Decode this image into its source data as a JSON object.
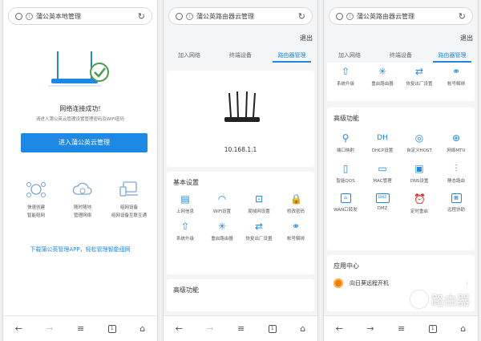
{
  "colors": {
    "accent": "#1e88e5",
    "success": "#43a047"
  },
  "phone1": {
    "url_title": "蒲公英本地管理",
    "success_title": "网络连接成功!",
    "success_sub": "请进入蒲公英云管理设置管理密码及WiFi密码",
    "enter_button": "进入蒲公英云管理",
    "features": [
      {
        "icon": "network-icon",
        "line1": "快速创建",
        "line2": "智能组网"
      },
      {
        "icon": "cloud-gear-icon",
        "line1": "随时随地",
        "line2": "管理网络"
      },
      {
        "icon": "devices-icon",
        "line1": "组网设备",
        "line2": "组网设备互联互通"
      }
    ],
    "download_link": "下载蒲公英管理APP，轻松管理智能组网",
    "nav": [
      "←",
      "→",
      "≡",
      "1",
      "⌂"
    ]
  },
  "phone2": {
    "url_title": "蒲公英路由器云管理",
    "logout": "退出",
    "tabs": [
      "加入网络",
      "终端设备",
      "路由器管理"
    ],
    "ip": "10.168.1.1",
    "basic_title": "基本设置",
    "basic_items": [
      {
        "icon": "doc-icon",
        "glyph": "▤",
        "label": "上网信息"
      },
      {
        "icon": "wifi-icon",
        "glyph": "◠",
        "label": "WiFi设置"
      },
      {
        "icon": "lan-icon",
        "glyph": "⊡",
        "label": "局域网设置"
      },
      {
        "icon": "lock-icon",
        "glyph": "🔒",
        "label": "修改密码"
      },
      {
        "icon": "upgrade-icon",
        "glyph": "⇧",
        "label": "系统升级"
      },
      {
        "icon": "restart-icon",
        "glyph": "✳",
        "label": "重启路由器"
      },
      {
        "icon": "reset-icon",
        "glyph": "⇄",
        "label": "恢复出厂设置"
      },
      {
        "icon": "unbind-icon",
        "glyph": "⚭",
        "label": "帐号解绑"
      }
    ],
    "advanced_title": "高级功能",
    "nav": [
      "←",
      "→",
      "≡",
      "1",
      "⌂"
    ]
  },
  "phone3": {
    "url_title": "蒲公英路由器云管理",
    "logout": "退出",
    "tabs": [
      "加入网络",
      "终端设备",
      "路由器管理"
    ],
    "top_items": [
      {
        "icon": "upgrade-icon",
        "glyph": "⇧",
        "label": "系统升级"
      },
      {
        "icon": "restart-icon",
        "glyph": "✳",
        "label": "重启路由器"
      },
      {
        "icon": "reset-icon",
        "glyph": "⇄",
        "label": "恢复出厂设置"
      },
      {
        "icon": "unbind-icon",
        "glyph": "⚭",
        "label": "帐号解绑"
      }
    ],
    "advanced_title": "高级功能",
    "advanced_items": [
      {
        "icon": "port-map-icon",
        "glyph": "⚲",
        "label": "端口映射",
        "box": false
      },
      {
        "icon": "dhcp-icon",
        "glyph": "DH",
        "label": "DHCP设置",
        "box": false
      },
      {
        "icon": "host-icon",
        "glyph": "◎",
        "label": "自定义HOST",
        "box": false
      },
      {
        "icon": "mtu-icon",
        "glyph": "⊕",
        "label": "网络MTU",
        "box": false
      },
      {
        "icon": "qos-icon",
        "glyph": "▯",
        "label": "智能QOS",
        "box": false
      },
      {
        "icon": "mac-icon",
        "glyph": "▭",
        "label": "MAC管理",
        "box": false
      },
      {
        "icon": "dns-icon",
        "glyph": "▣",
        "label": "DNS设置",
        "box": false
      },
      {
        "icon": "static-route-icon",
        "glyph": "⫶",
        "label": "静态路由",
        "box": false
      },
      {
        "icon": "wan-forward-icon",
        "glyph": "⌂",
        "label": "WAN口转发",
        "box": true
      },
      {
        "icon": "dmz-icon",
        "glyph": "DMZ",
        "label": "DMZ",
        "box": true
      },
      {
        "icon": "timer-restart-icon",
        "glyph": "⏰",
        "label": "定时重启",
        "box": false
      },
      {
        "icon": "remote-assist-icon",
        "glyph": "▦",
        "label": "远程协助",
        "box": true
      }
    ],
    "app_center_title": "应用中心",
    "app_item": "向日葵远程开机",
    "nav": [
      "←",
      "→",
      "≡",
      "1",
      "⌂"
    ]
  },
  "watermark": "路由器"
}
